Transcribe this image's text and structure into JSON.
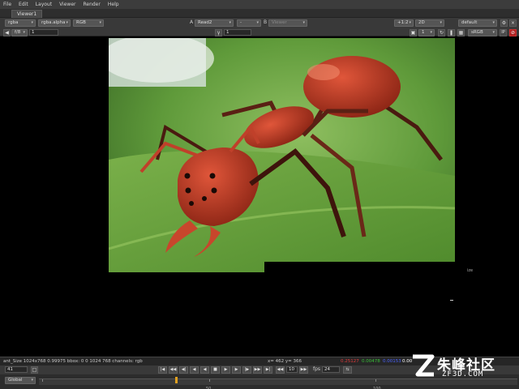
{
  "menu": [
    "File",
    "Edit",
    "Layout",
    "Viewer",
    "Render",
    "Help"
  ],
  "tab": "Viewer1",
  "toolbar1": {
    "layer": "rgba",
    "alpha": "rgba.alpha",
    "display_channels": "RGB",
    "input_a_label": "A",
    "input_a": "Read2",
    "composite": "-",
    "input_b_label": "B",
    "input_b": "Viewer",
    "zoom": "+1:2",
    "view_mode": "2D",
    "lut": "default"
  },
  "toolbar2": {
    "frame_mode": "f/8",
    "frame_value": "1",
    "gain_label": "1",
    "proxy_value": "1",
    "colorspace": "sRGB",
    "ip_label": "IP"
  },
  "viewer": {
    "format_label": "ize"
  },
  "info": {
    "format": "ant_Size 1024x768 0.99975 bbox: 0 0 1024 768 channels: rgb",
    "coords": "x= 462 y= 366",
    "r": "0.25127",
    "g": "0.00478",
    "b": "0.00153",
    "a": "0.00",
    "colors": {
      "r": "#e03a3a",
      "g": "#38c038",
      "b": "#4a64ff"
    }
  },
  "playback": {
    "frame": "41",
    "skip_frames": "10",
    "fps_label": "fps",
    "fps": "24"
  },
  "timeline": {
    "scope": "Global",
    "ticks": [
      "50",
      "100"
    ]
  },
  "watermark": {
    "zh": "朱峰社区",
    "en": "ZF3D.COM"
  }
}
